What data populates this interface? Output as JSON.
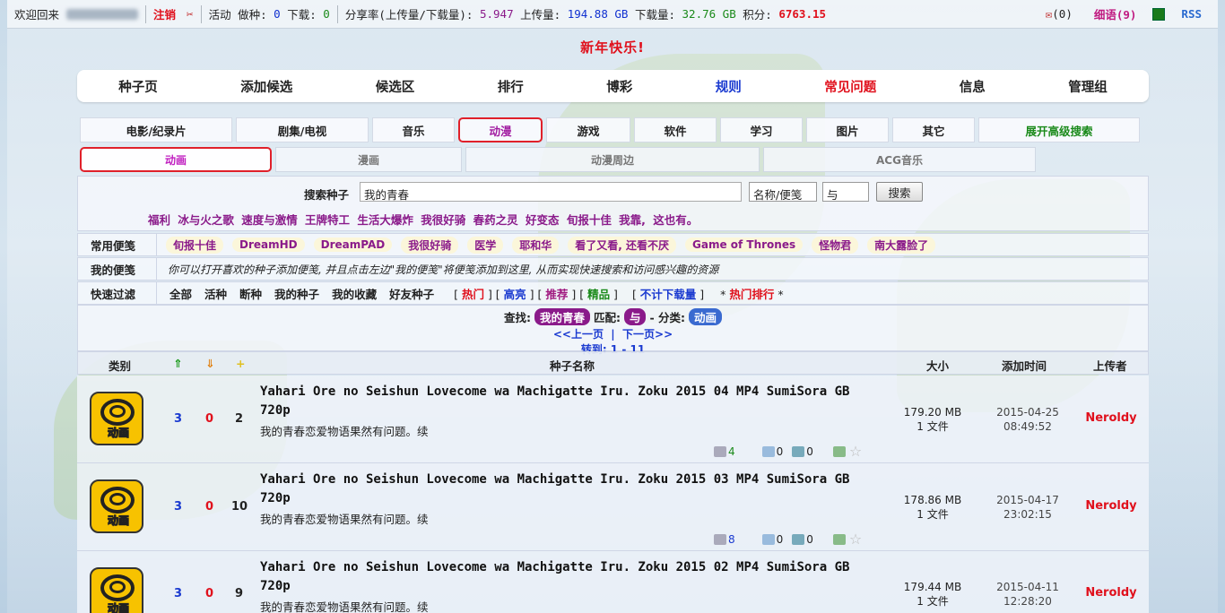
{
  "topbar": {
    "welcome": "欢迎回来",
    "logout": "注销",
    "activity_label": "活动",
    "seeding_label": "做种:",
    "seeding": "0",
    "leeching_label": "下载:",
    "leeching": "0",
    "ratio_label": "分享率(上传量/下载量):",
    "ratio": "5.947",
    "upload_label": "上传量:",
    "upload": "194.88 GB",
    "download_label": "下载量:",
    "download": "32.76 GB",
    "points_label": "积分:",
    "points": "6763.15",
    "mail_count": "(0)",
    "shoutbox": "细语(9)",
    "rss": "RSS"
  },
  "banner": "新年快乐!",
  "nav": [
    "种子页",
    "添加候选",
    "候选区",
    "排行",
    "博彩",
    "规则",
    "常见问题",
    "信息",
    "管理组"
  ],
  "categories": [
    "电影/纪录片",
    "剧集/电视",
    "音乐",
    "动漫",
    "游戏",
    "软件",
    "学习",
    "图片",
    "其它",
    "展开高级搜索"
  ],
  "subcategories": [
    "动画",
    "漫画",
    "动漫周边",
    "ACG音乐"
  ],
  "search": {
    "label": "搜索种子",
    "value": "我的青春",
    "field": "名称/便笺",
    "mode": "与",
    "button": "搜索"
  },
  "hot_keywords": "福利 冰与火之歌 速度与激情 王牌特工 生活大爆炸 我很好骑 春药之灵 好变态 旬报十佳 我靠, 这也有。",
  "common_notes": {
    "label": "常用便笺",
    "items": [
      "旬报十佳",
      "DreamHD",
      "DreamPAD",
      "我很好骑",
      "医学",
      "耶和华",
      "看了又看, 还看不厌",
      "Game of Thrones",
      "怪物君",
      "南大露脸了"
    ]
  },
  "my_notes": {
    "label": "我的便笺",
    "text": "你可以打开喜欢的种子添加便笺, 并且点击左边\"我的便笺\"将便笺添加到这里, 从而实现快速搜索和访问感兴趣的资源"
  },
  "quick_filter": {
    "label": "快速过滤",
    "items": [
      "全部",
      "活种",
      "断种",
      "我的种子",
      "我的收藏",
      "好友种子"
    ],
    "hot": "热门",
    "highlight": "高亮",
    "recommend": "推荐",
    "quality": "精品",
    "free": "不计下载量",
    "hot_rank": "热门排行"
  },
  "find": {
    "label": "查找:",
    "keyword": "我的青春",
    "match_label": "匹配:",
    "match": "与",
    "cat_label": "- 分类:",
    "cat": "动画",
    "prev": "<<上一页",
    "next": "下一页>>",
    "goto": "转到: 1 - 11"
  },
  "table_headers": {
    "type": "类别",
    "name": "种子名称",
    "size": "大小",
    "added": "添加时间",
    "uploader": "上传者"
  },
  "rows": [
    {
      "title": "Yahari Ore no Seishun Lovecome wa Machigatte Iru. Zoku 2015 04 MP4 SumiSora GB 720p",
      "subtitle": "我的青春恋爱物语果然有问题。续",
      "seeders": "3",
      "leechers": "0",
      "completed": "2",
      "size": "179.20 MB",
      "files": "1 文件",
      "date": "2015-04-25",
      "time": "08:49:52",
      "uploader": "Neroldy",
      "likes": "4",
      "comments": "0",
      "replies": "0",
      "icon_label": "动画"
    },
    {
      "title": "Yahari Ore no Seishun Lovecome wa Machigatte Iru. Zoku 2015 03 MP4 SumiSora GB 720p",
      "subtitle": "我的青春恋爱物语果然有问题。续",
      "seeders": "3",
      "leechers": "0",
      "completed": "10",
      "size": "178.86 MB",
      "files": "1 文件",
      "date": "2015-04-17",
      "time": "23:02:15",
      "uploader": "Neroldy",
      "likes": "8",
      "comments": "0",
      "replies": "0",
      "icon_label": "动画"
    },
    {
      "title": "Yahari Ore no Seishun Lovecome wa Machigatte Iru. Zoku 2015 02 MP4 SumiSora GB 720p",
      "subtitle": "我的青春恋爱物语果然有问题。续",
      "seeders": "3",
      "leechers": "0",
      "completed": "9",
      "size": "179.44 MB",
      "files": "1 文件",
      "date": "2015-04-11",
      "time": "12:28:20",
      "uploader": "Neroldy",
      "likes": "",
      "comments": "",
      "replies": "",
      "icon_label": "动画"
    }
  ]
}
